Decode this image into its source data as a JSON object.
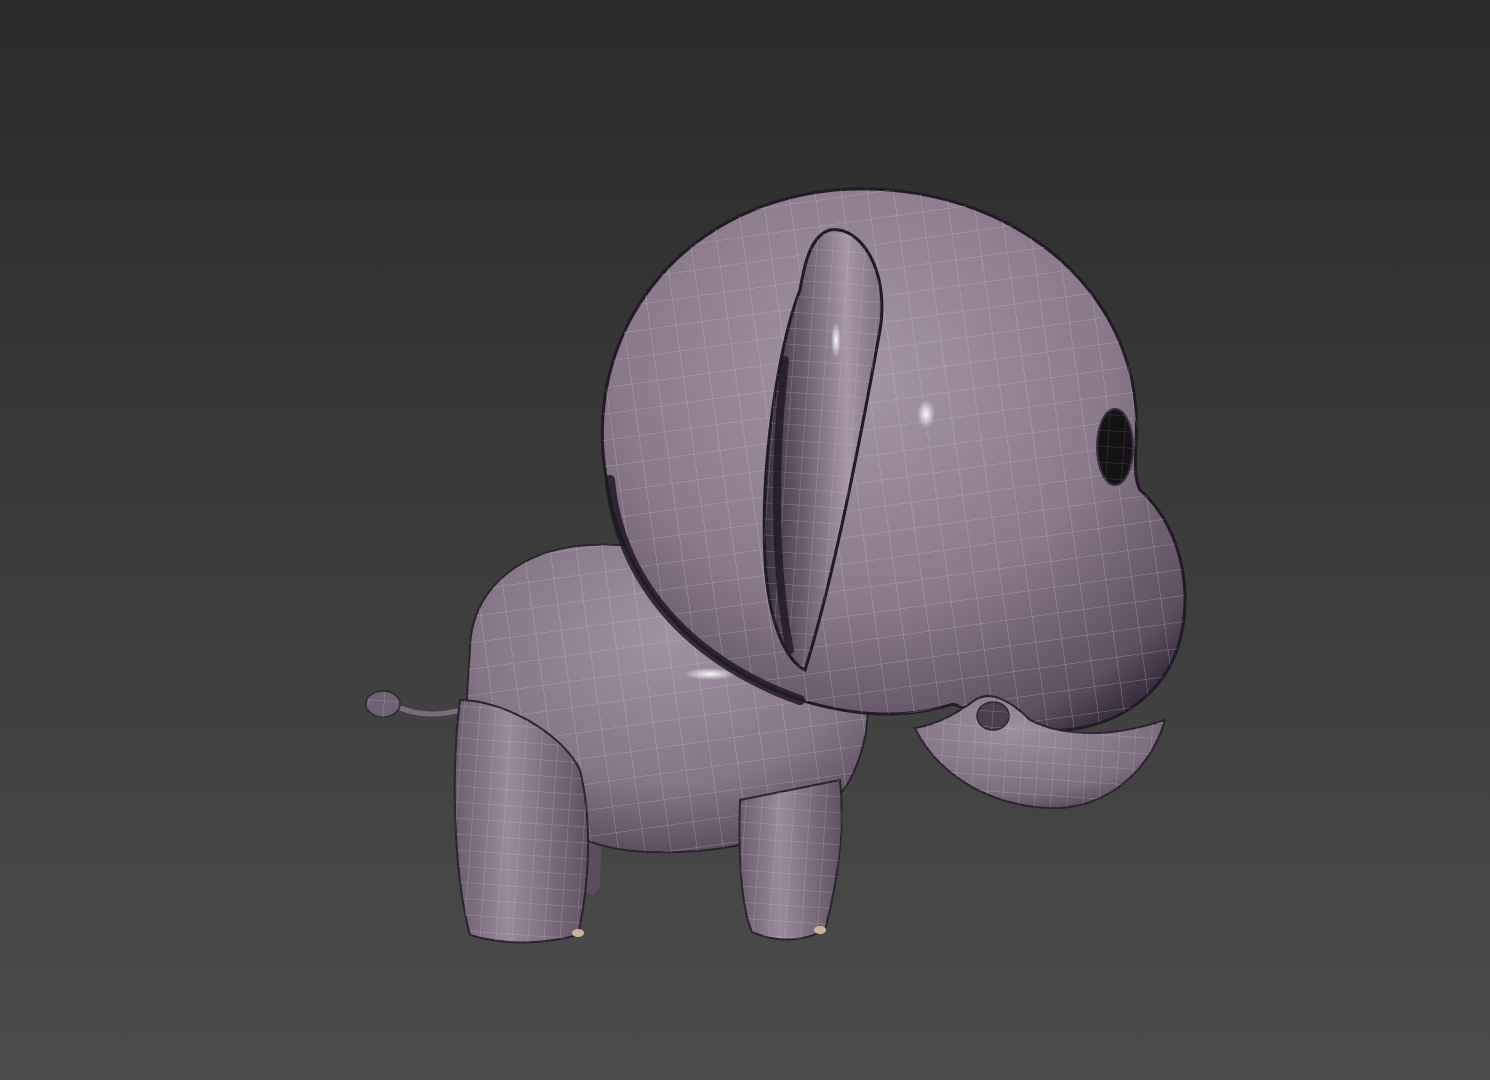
{
  "viewport": {
    "background_top": "#2a2a2a",
    "background_bottom": "#4c4c4c",
    "shading_mode": "smooth-highlights-edged-faces"
  },
  "model": {
    "subject": "cartoon-elephant",
    "base_color": "#8a7a8c",
    "shadow_color": "#3e3342",
    "highlight_color": "#a596a8",
    "wire_color": "#d2cdd2",
    "eye_color": "#141214",
    "foot_pad_color": "#c8b49a"
  }
}
